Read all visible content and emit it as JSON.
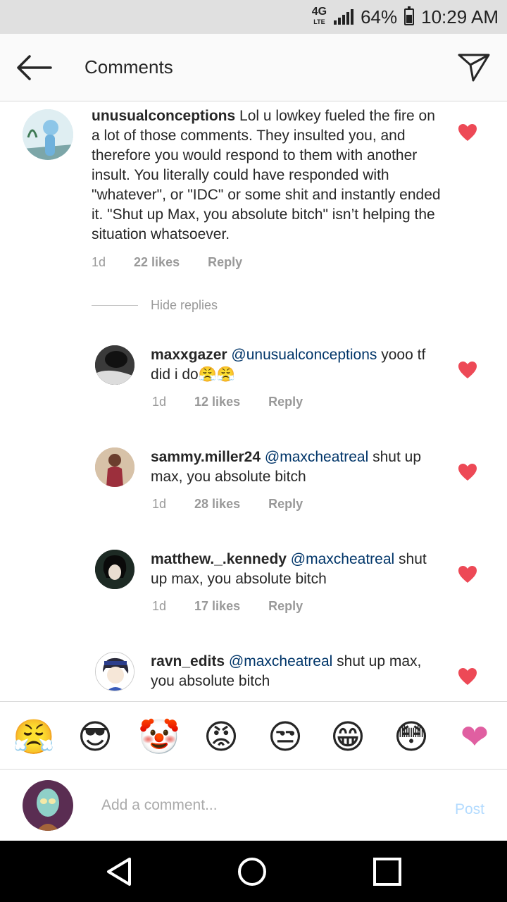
{
  "status": {
    "network": "4G",
    "network_sub": "LTE",
    "battery": "64%",
    "time": "10:29 AM"
  },
  "header": {
    "title": "Comments",
    "back_icon": "arrow-left-icon",
    "share_icon": "send-icon"
  },
  "main_comment": {
    "username": "unusualconceptions",
    "text": "Lol u lowkey fueled the fire on a lot of those comments. They insulted you, and therefore you would respond to them with another insult. You literally could have responded with \"whatever\", or \"IDC\" or some shit and instantly ended it. \"Shut up Max, you absolute bitch\" isn’t helping the situation whatsoever.",
    "age": "1d",
    "likes": "22 likes",
    "reply": "Reply"
  },
  "hide_replies": "Hide replies",
  "replies": [
    {
      "username": "maxxgazer",
      "mention": "@unusualconceptions",
      "text": "yooo tf did i do😤😤",
      "age": "1d",
      "likes": "12 likes",
      "reply": "Reply"
    },
    {
      "username": "sammy.miller24",
      "mention": "@maxcheatreal",
      "text": "shut up max, you absolute bitch",
      "age": "1d",
      "likes": "28 likes",
      "reply": "Reply"
    },
    {
      "username": "matthew._.kennedy",
      "mention": "@maxcheatreal",
      "text": "shut up max, you absolute bitch",
      "age": "1d",
      "likes": "17 likes",
      "reply": "Reply"
    },
    {
      "username": "ravn_edits",
      "mention": "@maxcheatreal",
      "text": "shut up max, you absolute bitch"
    }
  ],
  "emoji_bar": [
    "😤",
    "😎",
    "🤡",
    "😡",
    "😒",
    "😁",
    "😳",
    "❤"
  ],
  "input": {
    "placeholder": "Add a comment...",
    "post_label": "Post"
  },
  "colors": {
    "heart": "#ed4956",
    "mention": "#003569",
    "post_disabled": "#b3dbff"
  }
}
